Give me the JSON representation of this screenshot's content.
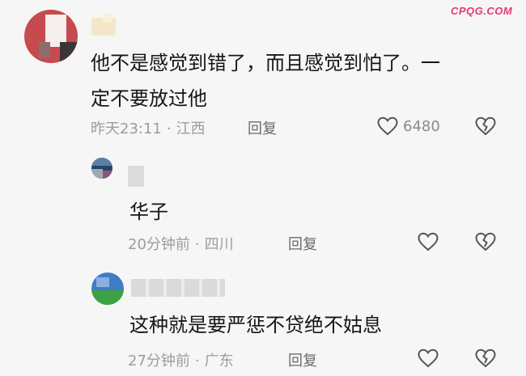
{
  "watermark": "CPQG.COM",
  "comment": {
    "text_line1": "他不是感觉到错了，而且感觉到怕了。一",
    "text_line2": "定不要放过他",
    "time": "昨天23:11",
    "location": "江西",
    "reply_label": "回复",
    "like_count": "6480"
  },
  "replies": [
    {
      "text": "华子",
      "time": "20分钟前",
      "location": "四川",
      "reply_label": "回复"
    },
    {
      "text": "这种就是要严惩不贷绝不姑息",
      "time": "27分钟前",
      "location": "广东",
      "reply_label": "回复"
    }
  ],
  "meta_separator": "·",
  "colors": {
    "background": "#f6f6f6",
    "text": "#161616",
    "meta": "#9c9c9c",
    "watermark": "#e8367a"
  },
  "icons": [
    "heart-outline-icon",
    "broken-heart-icon"
  ]
}
